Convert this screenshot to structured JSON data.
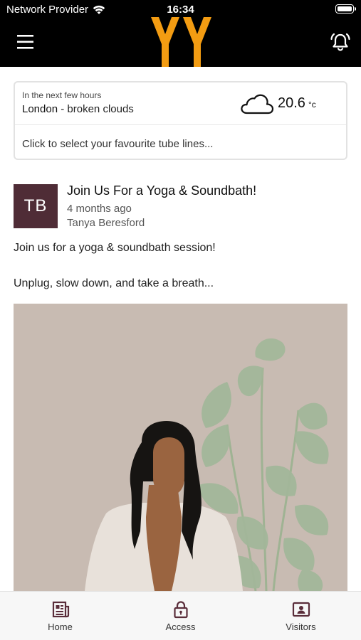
{
  "status_bar": {
    "carrier": "Network Provider",
    "time": "16:34"
  },
  "header": {
    "logo_text": "YY",
    "menu_icon": "hamburger-icon",
    "alert_icon": "bell-icon"
  },
  "weather": {
    "hint": "In the next few hours",
    "location": "London",
    "separator": " - ",
    "condition": "broken clouds",
    "temperature": "20.6",
    "unit": "°c",
    "tube_prompt": "Click to select your favourite tube lines..."
  },
  "post": {
    "avatar_initials": "TB",
    "title": "Join Us For a Yoga & Soundbath!",
    "time_ago": "4 months ago",
    "author": "Tanya Beresford",
    "body_line1": "Join us for a yoga & soundbath session!",
    "body_line2": "Unplug, slow down, and take a breath..."
  },
  "bottom_nav": [
    {
      "label": "Home",
      "icon": "newspaper-icon"
    },
    {
      "label": "Access",
      "icon": "lock-icon"
    },
    {
      "label": "Visitors",
      "icon": "id-card-icon"
    }
  ],
  "colors": {
    "header_bg": "#000000",
    "logo": "#f39c12",
    "avatar_bg": "#4f2c36",
    "nav_icon": "#5a2d3a",
    "image_bg": "#c8bbb2"
  }
}
